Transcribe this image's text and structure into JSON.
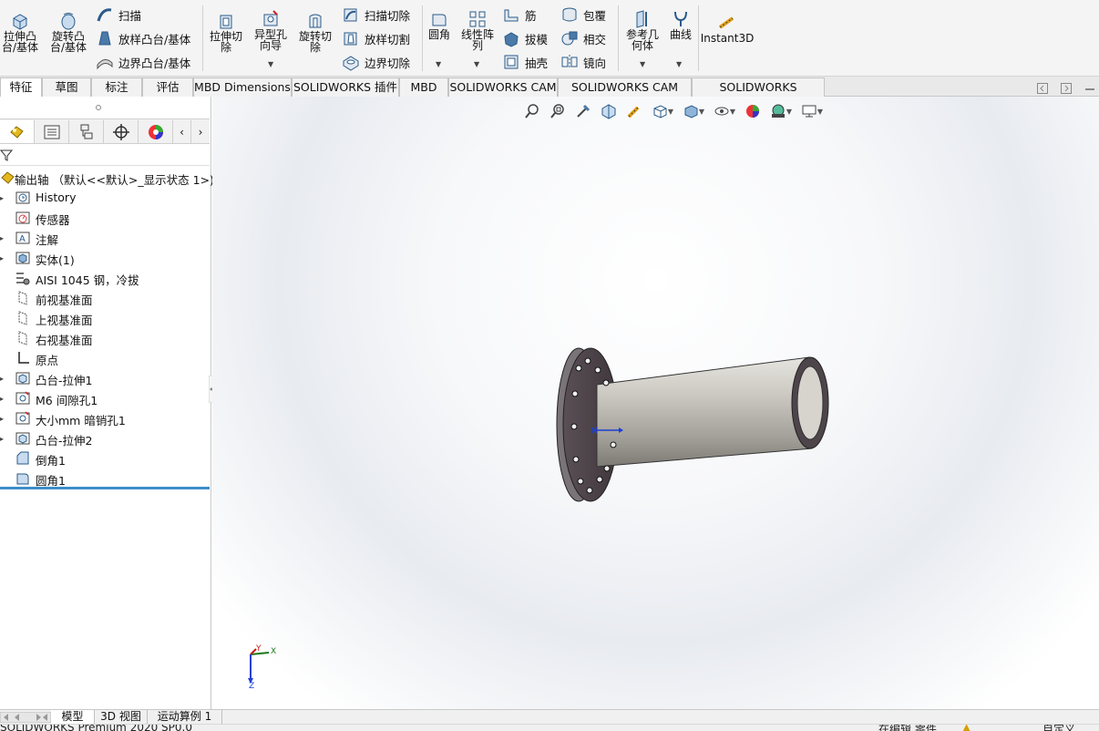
{
  "ribbon": {
    "extrude_boss": "拉伸凸\n台/基体",
    "revolve_boss": "旋转凸\n台/基体",
    "sweep": "扫描",
    "loft_boss": "放样凸台/基体",
    "boundary_boss": "边界凸台/基体",
    "extrude_cut": "拉伸切\n除",
    "hole_wizard": "异型孔\n向导",
    "revolve_cut": "旋转切\n除",
    "swept_cut": "扫描切除",
    "lofted_cut": "放样切割",
    "boundary_cut": "边界切除",
    "fillet": "圆角",
    "linear_pattern": "线性阵\n列",
    "rib": "筋",
    "draft": "拔模",
    "shell": "抽壳",
    "wrap": "包覆",
    "intersect": "相交",
    "mirror": "镜向",
    "ref_geometry": "参考几\n何体",
    "curves": "曲线",
    "instant3d": "Instant3D"
  },
  "tabs": [
    "特征",
    "草图",
    "标注",
    "评估",
    "MBD Dimensions",
    "SOLIDWORKS 插件",
    "MBD",
    "SOLIDWORKS CAM",
    "SOLIDWORKS CAM TBM",
    "SOLIDWORKS Inspection"
  ],
  "tree": {
    "root": "输出轴 （默认<<默认>_显示状态 1>)",
    "items": [
      {
        "label": "History",
        "icon": "history-icon",
        "expandable": true
      },
      {
        "label": "传感器",
        "icon": "sensor-icon",
        "expandable": false
      },
      {
        "label": "注解",
        "icon": "annotation-icon",
        "expandable": true
      },
      {
        "label": "实体(1)",
        "icon": "solid-body-icon",
        "expandable": true
      },
      {
        "label": "AISI 1045 钢，冷拔",
        "icon": "material-icon",
        "expandable": false
      },
      {
        "label": "前视基准面",
        "icon": "plane-icon",
        "expandable": false
      },
      {
        "label": "上视基准面",
        "icon": "plane-icon",
        "expandable": false
      },
      {
        "label": "右视基准面",
        "icon": "plane-icon",
        "expandable": false
      },
      {
        "label": "原点",
        "icon": "origin-icon",
        "expandable": false
      },
      {
        "label": "凸台-拉伸1",
        "icon": "extrude-icon",
        "expandable": true
      },
      {
        "label": "M6 间隙孔1",
        "icon": "hole-icon",
        "expandable": true
      },
      {
        "label": "大小mm 暗销孔1",
        "icon": "hole-icon",
        "expandable": true
      },
      {
        "label": "凸台-拉伸2",
        "icon": "extrude-icon",
        "expandable": true
      },
      {
        "label": "倒角1",
        "icon": "chamfer-icon",
        "expandable": false
      },
      {
        "label": "圆角1",
        "icon": "fillet-icon",
        "expandable": false
      }
    ]
  },
  "triad": {
    "x": "X",
    "y": "Y",
    "z": "Z"
  },
  "bottom_tabs": [
    "模型",
    "3D 视图",
    "运动算例 1"
  ],
  "status": {
    "left": "SOLIDWORKS Premium 2020 SP0.0",
    "mid": "在编辑 零件",
    "right": "自定义"
  },
  "colors": {
    "accent": "#3d8ec9",
    "part": "#b5b2ab",
    "flange": "#4a4047"
  }
}
